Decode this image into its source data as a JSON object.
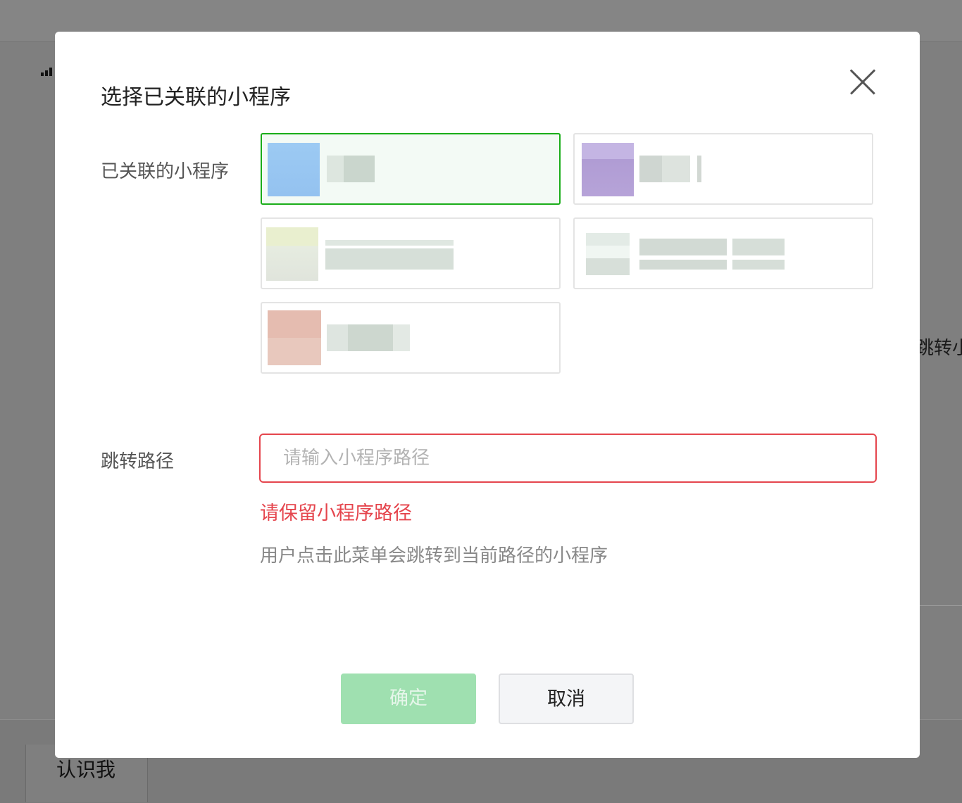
{
  "background": {
    "right_text": "跳转小",
    "bottom_tab_label": "认识我"
  },
  "dialog": {
    "title": "选择已关联的小程序",
    "linked_label": "已关联的小程序",
    "apps": [
      {
        "icon_color": "#9ccaf3",
        "selected": true
      },
      {
        "icon_color": "#b6a3d8",
        "selected": false
      },
      {
        "icon_color": "#e9efcf",
        "selected": false
      },
      {
        "icon_color": "#e3ebe6",
        "selected": false
      },
      {
        "icon_color": "#e7c3b9",
        "selected": false
      }
    ],
    "path_label": "跳转路径",
    "path_placeholder": "请输入小程序路径",
    "path_value": "",
    "error_text": "请保留小程序路径",
    "hint_text": "用户点击此菜单会跳转到当前路径的小程序",
    "confirm_label": "确定",
    "cancel_label": "取消"
  },
  "colors": {
    "accent_green": "#1aad19",
    "error_red": "#e5454d",
    "overlay": "#7f7f7f"
  }
}
